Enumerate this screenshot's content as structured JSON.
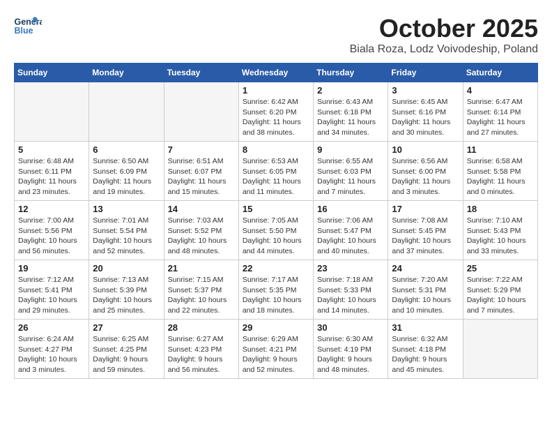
{
  "header": {
    "logo_general": "General",
    "logo_blue": "Blue",
    "month": "October 2025",
    "location": "Biala Roza, Lodz Voivodeship, Poland"
  },
  "weekdays": [
    "Sunday",
    "Monday",
    "Tuesday",
    "Wednesday",
    "Thursday",
    "Friday",
    "Saturday"
  ],
  "weeks": [
    [
      {
        "day": "",
        "info": ""
      },
      {
        "day": "",
        "info": ""
      },
      {
        "day": "",
        "info": ""
      },
      {
        "day": "1",
        "info": "Sunrise: 6:42 AM\nSunset: 6:20 PM\nDaylight: 11 hours\nand 38 minutes."
      },
      {
        "day": "2",
        "info": "Sunrise: 6:43 AM\nSunset: 6:18 PM\nDaylight: 11 hours\nand 34 minutes."
      },
      {
        "day": "3",
        "info": "Sunrise: 6:45 AM\nSunset: 6:16 PM\nDaylight: 11 hours\nand 30 minutes."
      },
      {
        "day": "4",
        "info": "Sunrise: 6:47 AM\nSunset: 6:14 PM\nDaylight: 11 hours\nand 27 minutes."
      }
    ],
    [
      {
        "day": "5",
        "info": "Sunrise: 6:48 AM\nSunset: 6:11 PM\nDaylight: 11 hours\nand 23 minutes."
      },
      {
        "day": "6",
        "info": "Sunrise: 6:50 AM\nSunset: 6:09 PM\nDaylight: 11 hours\nand 19 minutes."
      },
      {
        "day": "7",
        "info": "Sunrise: 6:51 AM\nSunset: 6:07 PM\nDaylight: 11 hours\nand 15 minutes."
      },
      {
        "day": "8",
        "info": "Sunrise: 6:53 AM\nSunset: 6:05 PM\nDaylight: 11 hours\nand 11 minutes."
      },
      {
        "day": "9",
        "info": "Sunrise: 6:55 AM\nSunset: 6:03 PM\nDaylight: 11 hours\nand 7 minutes."
      },
      {
        "day": "10",
        "info": "Sunrise: 6:56 AM\nSunset: 6:00 PM\nDaylight: 11 hours\nand 3 minutes."
      },
      {
        "day": "11",
        "info": "Sunrise: 6:58 AM\nSunset: 5:58 PM\nDaylight: 11 hours\nand 0 minutes."
      }
    ],
    [
      {
        "day": "12",
        "info": "Sunrise: 7:00 AM\nSunset: 5:56 PM\nDaylight: 10 hours\nand 56 minutes."
      },
      {
        "day": "13",
        "info": "Sunrise: 7:01 AM\nSunset: 5:54 PM\nDaylight: 10 hours\nand 52 minutes."
      },
      {
        "day": "14",
        "info": "Sunrise: 7:03 AM\nSunset: 5:52 PM\nDaylight: 10 hours\nand 48 minutes."
      },
      {
        "day": "15",
        "info": "Sunrise: 7:05 AM\nSunset: 5:50 PM\nDaylight: 10 hours\nand 44 minutes."
      },
      {
        "day": "16",
        "info": "Sunrise: 7:06 AM\nSunset: 5:47 PM\nDaylight: 10 hours\nand 40 minutes."
      },
      {
        "day": "17",
        "info": "Sunrise: 7:08 AM\nSunset: 5:45 PM\nDaylight: 10 hours\nand 37 minutes."
      },
      {
        "day": "18",
        "info": "Sunrise: 7:10 AM\nSunset: 5:43 PM\nDaylight: 10 hours\nand 33 minutes."
      }
    ],
    [
      {
        "day": "19",
        "info": "Sunrise: 7:12 AM\nSunset: 5:41 PM\nDaylight: 10 hours\nand 29 minutes."
      },
      {
        "day": "20",
        "info": "Sunrise: 7:13 AM\nSunset: 5:39 PM\nDaylight: 10 hours\nand 25 minutes."
      },
      {
        "day": "21",
        "info": "Sunrise: 7:15 AM\nSunset: 5:37 PM\nDaylight: 10 hours\nand 22 minutes."
      },
      {
        "day": "22",
        "info": "Sunrise: 7:17 AM\nSunset: 5:35 PM\nDaylight: 10 hours\nand 18 minutes."
      },
      {
        "day": "23",
        "info": "Sunrise: 7:18 AM\nSunset: 5:33 PM\nDaylight: 10 hours\nand 14 minutes."
      },
      {
        "day": "24",
        "info": "Sunrise: 7:20 AM\nSunset: 5:31 PM\nDaylight: 10 hours\nand 10 minutes."
      },
      {
        "day": "25",
        "info": "Sunrise: 7:22 AM\nSunset: 5:29 PM\nDaylight: 10 hours\nand 7 minutes."
      }
    ],
    [
      {
        "day": "26",
        "info": "Sunrise: 6:24 AM\nSunset: 4:27 PM\nDaylight: 10 hours\nand 3 minutes."
      },
      {
        "day": "27",
        "info": "Sunrise: 6:25 AM\nSunset: 4:25 PM\nDaylight: 9 hours\nand 59 minutes."
      },
      {
        "day": "28",
        "info": "Sunrise: 6:27 AM\nSunset: 4:23 PM\nDaylight: 9 hours\nand 56 minutes."
      },
      {
        "day": "29",
        "info": "Sunrise: 6:29 AM\nSunset: 4:21 PM\nDaylight: 9 hours\nand 52 minutes."
      },
      {
        "day": "30",
        "info": "Sunrise: 6:30 AM\nSunset: 4:19 PM\nDaylight: 9 hours\nand 48 minutes."
      },
      {
        "day": "31",
        "info": "Sunrise: 6:32 AM\nSunset: 4:18 PM\nDaylight: 9 hours\nand 45 minutes."
      },
      {
        "day": "",
        "info": ""
      }
    ]
  ]
}
